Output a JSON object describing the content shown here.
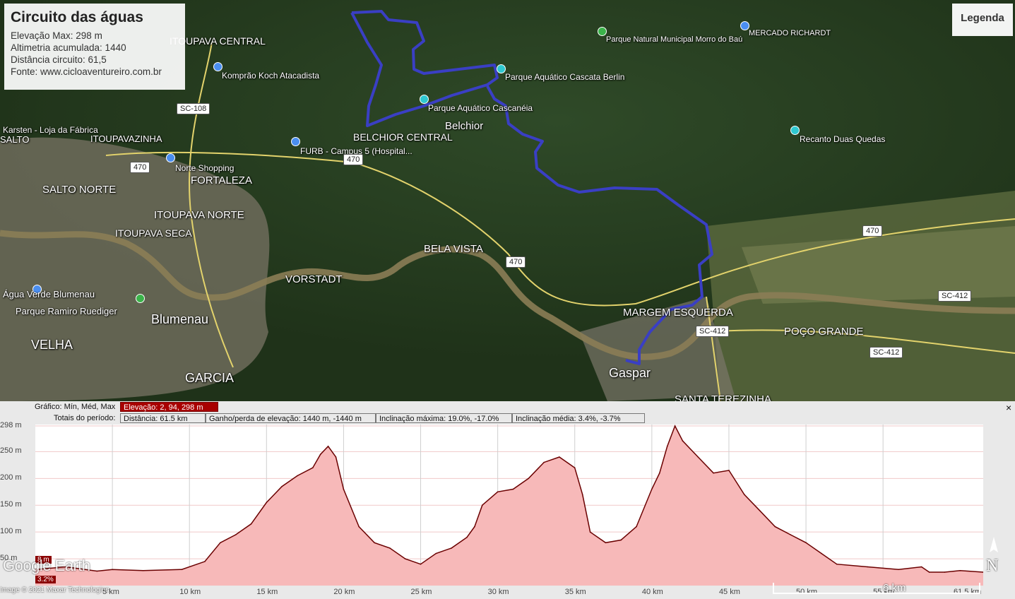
{
  "info": {
    "title": "Circuito das águas",
    "lines": [
      "Elevação Max: 298 m",
      "Altimetria acumulada: 1440",
      "Distância circuito: 61,5",
      "Fonte: www.cicloaventureiro.com.br"
    ]
  },
  "legend_label": "Legenda",
  "map_labels": {
    "itoupava_central": "ITOUPAVA CENTRAL",
    "kompran": "Komprão Koch Atacadista",
    "karsten": "Karsten - Loja da Fábrica",
    "salto": "SALTO",
    "itoupavazinha": "ITOUPAVAZINHA",
    "norte_shopping": "Norte Shopping",
    "fortaleza": "FORTALEZA",
    "salto_norte": "SALTO NORTE",
    "itoupava_norte": "ITOUPAVA NORTE",
    "itoupava_seca": "ITOUPAVA SECA",
    "agua_verde": "Água Verde Blumenau",
    "parque_ramiro": "Parque Ramiro Ruediger",
    "blumenau": "Blumenau",
    "velha": "VELHA",
    "garcia": "GARCIA",
    "vorstadt": "VORSTADT",
    "bela_vista": "BELA VISTA",
    "furb": "FURB - Campus 5 (Hospital...",
    "belchior_central": "BELCHIOR CENTRAL",
    "belchior": "Belchior",
    "cascaneia": "Parque Aquático Cascanéia",
    "cascata_berlin": "Parque Aquático Cascata Berlin",
    "morro_bau": "Parque Natural Municipal Morro do Baú",
    "mercado": "MERCADO RICHARDT",
    "recanto": "Recanto Duas Quedas",
    "margem": "MARGEM ESQUERDA",
    "poco_grande": "POÇO GRANDE",
    "gaspar": "Gaspar",
    "santa_terezinha": "SANTA TEREZINHA"
  },
  "shields": [
    "SC-108",
    "470",
    "470",
    "470",
    "470",
    "SC-412",
    "SC-412",
    "SC-412"
  ],
  "stats": {
    "row1_label": "Gráfico: Mín, Méd, Max",
    "row1_value": "Elevação: 2, 94, 298 m",
    "row2_label": "Totais do período:",
    "distance": "Distância: 61.5 km",
    "gain": "Ganho/perda de elevação: 1440 m, -1440 m",
    "max_slope": "Inclinação máxima: 19.0%, -17.0%",
    "avg_slope": "Inclinação média: 3.4%, -3.7%"
  },
  "close_symbol": "×",
  "badges": {
    "elev": "8 m",
    "slope": "3.2%"
  },
  "ge_logo": "Google Earth",
  "credit": "Image © 2021 Maxar Technologies",
  "scale_label": "6 km",
  "compass_n": "N",
  "colors": {
    "route": "#3a3fc4",
    "profile_fill": "#f7b9b9",
    "profile_line": "#6a0000",
    "panel_red": "#a80000"
  },
  "chart_data": {
    "type": "area",
    "title": "",
    "xlabel": "",
    "ylabel": "",
    "x_tick_labels": [
      "5 km",
      "10 km",
      "15 km",
      "20 km",
      "25 km",
      "30 km",
      "35 km",
      "40 km",
      "45 km",
      "50 km",
      "55 km",
      "61.5 km"
    ],
    "y_tick_labels": [
      "298 m",
      "250 m",
      "200 m",
      "150 m",
      "100 m",
      "50 m"
    ],
    "xlim": [
      0,
      61.5
    ],
    "ylim": [
      0,
      298
    ],
    "x": [
      0,
      2,
      4,
      5,
      7,
      9.5,
      11,
      12,
      13,
      14,
      15,
      16,
      17,
      18,
      18.5,
      19,
      19.5,
      20,
      21,
      22,
      23,
      24,
      25,
      26,
      27,
      28,
      28.5,
      29,
      30,
      31,
      32,
      33,
      34,
      35,
      35.5,
      36,
      37,
      38,
      39,
      40,
      40.5,
      41,
      41.5,
      42,
      43,
      44,
      45,
      46,
      47,
      48,
      49,
      50,
      51,
      52,
      54,
      56,
      57.5,
      58,
      59,
      60,
      61.5
    ],
    "y": [
      30,
      35,
      27,
      30,
      28,
      30,
      45,
      80,
      95,
      115,
      155,
      185,
      205,
      220,
      245,
      260,
      240,
      180,
      110,
      80,
      70,
      50,
      40,
      60,
      70,
      90,
      110,
      150,
      175,
      180,
      200,
      230,
      240,
      220,
      170,
      100,
      80,
      85,
      110,
      180,
      210,
      260,
      298,
      270,
      240,
      210,
      215,
      170,
      140,
      110,
      95,
      80,
      60,
      40,
      35,
      30,
      35,
      25,
      25,
      28,
      25
    ]
  }
}
